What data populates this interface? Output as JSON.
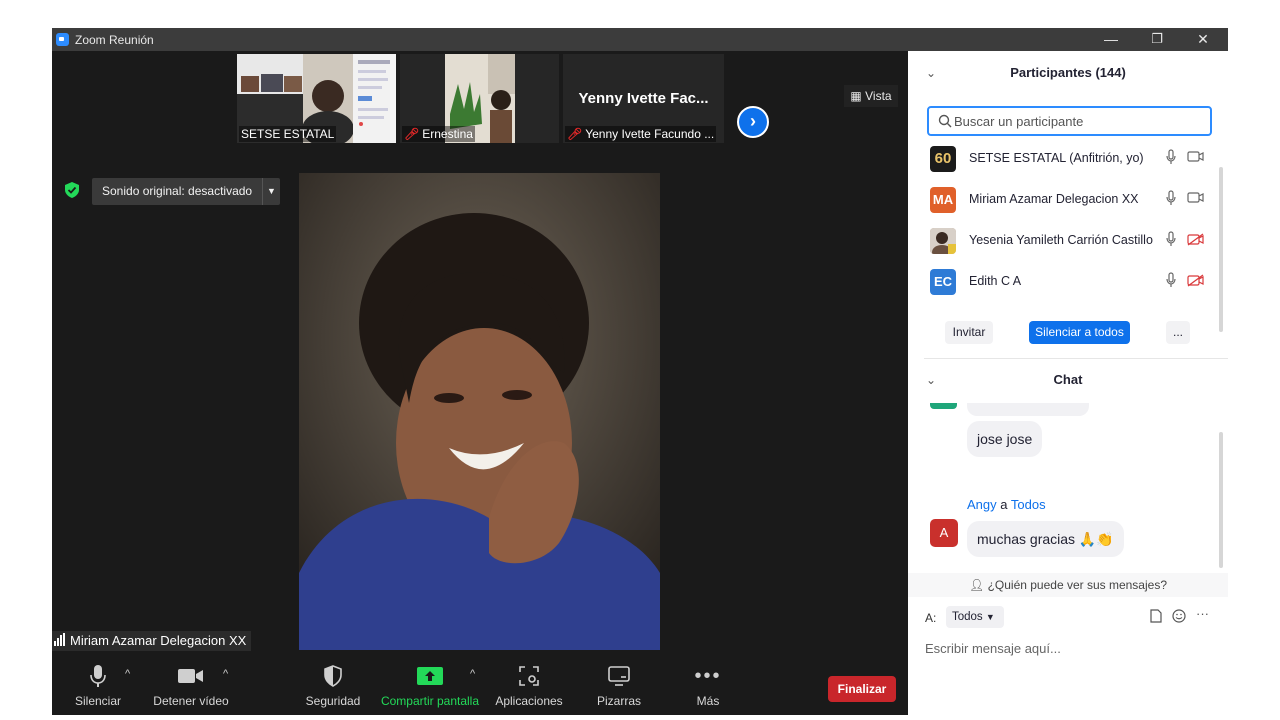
{
  "window": {
    "title": "Zoom Reunión",
    "minimize": "—",
    "restore": "❐",
    "close": "✕"
  },
  "thumbnails": [
    {
      "name": "SETSE ESTATAL",
      "muted": false,
      "big_name": ""
    },
    {
      "name": "Ernestina",
      "muted": true,
      "big_name": ""
    },
    {
      "name": "Yenny Ivette Facundo ...",
      "muted": true,
      "big_name": "Yenny Ivette Fac..."
    }
  ],
  "view_button": "Vista",
  "sound_button": "Sonido original: desactivado",
  "active_speaker": "Miriam Azamar Delegacion XX",
  "toolbar": {
    "mute": "Silenciar",
    "video": "Detener vídeo",
    "security": "Seguridad",
    "share": "Compartir pantalla",
    "apps": "Aplicaciones",
    "whiteboards": "Pizarras",
    "more": "Más",
    "end": "Finalizar"
  },
  "participants": {
    "header": "Participantes (144)",
    "search_placeholder": "Buscar un participante",
    "list": [
      {
        "initials": "60",
        "name": "SETSE ESTATAL (Anfitrión, yo)",
        "avatar_color": "#1b1b1b",
        "video_on": true
      },
      {
        "initials": "MA",
        "name": "Miriam Azamar Delegacion XX",
        "avatar_color": "#e0602a",
        "video_on": true
      },
      {
        "initials": "",
        "name": "Yesenia Yamileth Carrión Castillo",
        "avatar_color": "#b89880",
        "video_on": false
      },
      {
        "initials": "EC",
        "name": "Edith C A",
        "avatar_color": "#2e7bd6",
        "video_on": false
      }
    ],
    "invite": "Invitar",
    "mute_all": "Silenciar a todos",
    "more": "..."
  },
  "chat": {
    "header": "Chat",
    "messages": [
      {
        "text": "jose jose"
      },
      {
        "sender": "Angy",
        "connector": "a",
        "recipient": "Todos",
        "avatar_initial": "A",
        "text": "muchas gracias 🙏👏"
      }
    ],
    "who_can_see": "¿Quién puede ver sus mensajes?",
    "to_label": "A:",
    "to_value": "Todos",
    "input_placeholder": "Escribir mensaje aquí..."
  }
}
